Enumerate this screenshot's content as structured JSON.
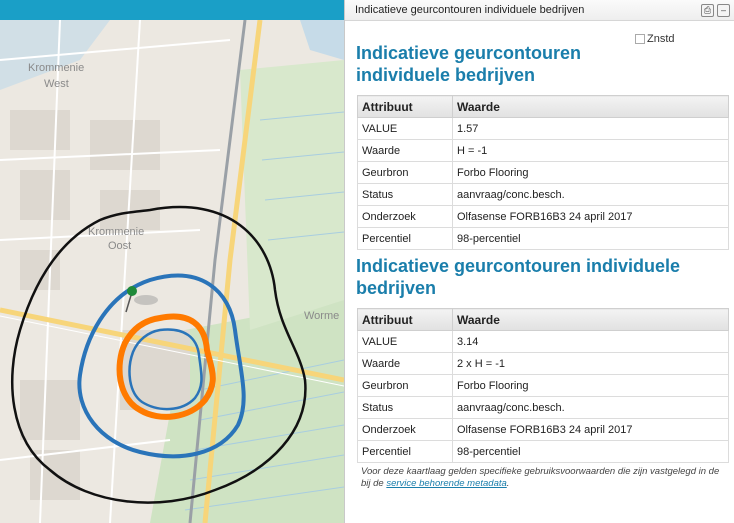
{
  "map": {
    "labels": [
      "Krommenie",
      "West",
      "Krommenie",
      "Oost",
      "Worme"
    ],
    "colors": {
      "outer_contour": "#111111",
      "blue_contour": "#2a74b9",
      "orange_contour": "#ff7a00",
      "pin": "#1f8a3a"
    }
  },
  "panel": {
    "header_title": "Indicatieve geurcontouren individuele bedrijven",
    "print_icon": "print-icon",
    "minimize_icon": "minimize-icon",
    "image_alt": "Znstd",
    "sections": [
      {
        "title": "Indicatieve geurcontouren individuele bedrijven",
        "col_attr": "Attribuut",
        "col_value": "Waarde",
        "rows": [
          {
            "key": "VALUE",
            "value": "1.57"
          },
          {
            "key": "Waarde",
            "value": "H = -1"
          },
          {
            "key": "Geurbron",
            "value": "Forbo Flooring"
          },
          {
            "key": "Status",
            "value": "aanvraag/conc.besch."
          },
          {
            "key": "Onderzoek",
            "value": "Olfasense FORB16B3 24 april 2017"
          },
          {
            "key": "Percentiel",
            "value": "98-percentiel"
          }
        ]
      },
      {
        "title": "Indicatieve geurcontouren individuele bedrijven",
        "col_attr": "Attribuut",
        "col_value": "Waarde",
        "rows": [
          {
            "key": "VALUE",
            "value": "3.14"
          },
          {
            "key": "Waarde",
            "value": "2 x H = -1"
          },
          {
            "key": "Geurbron",
            "value": "Forbo Flooring"
          },
          {
            "key": "Status",
            "value": "aanvraag/conc.besch."
          },
          {
            "key": "Onderzoek",
            "value": "Olfasense FORB16B3 24 april 2017"
          },
          {
            "key": "Percentiel",
            "value": "98-percentiel"
          }
        ]
      }
    ],
    "disclaimer_text": "Voor deze kaartlaag gelden specifieke gebruiksvoorwaarden die zijn vastgelegd in de bij de",
    "disclaimer_link": "service behorende metadata",
    "disclaimer_end": "."
  }
}
